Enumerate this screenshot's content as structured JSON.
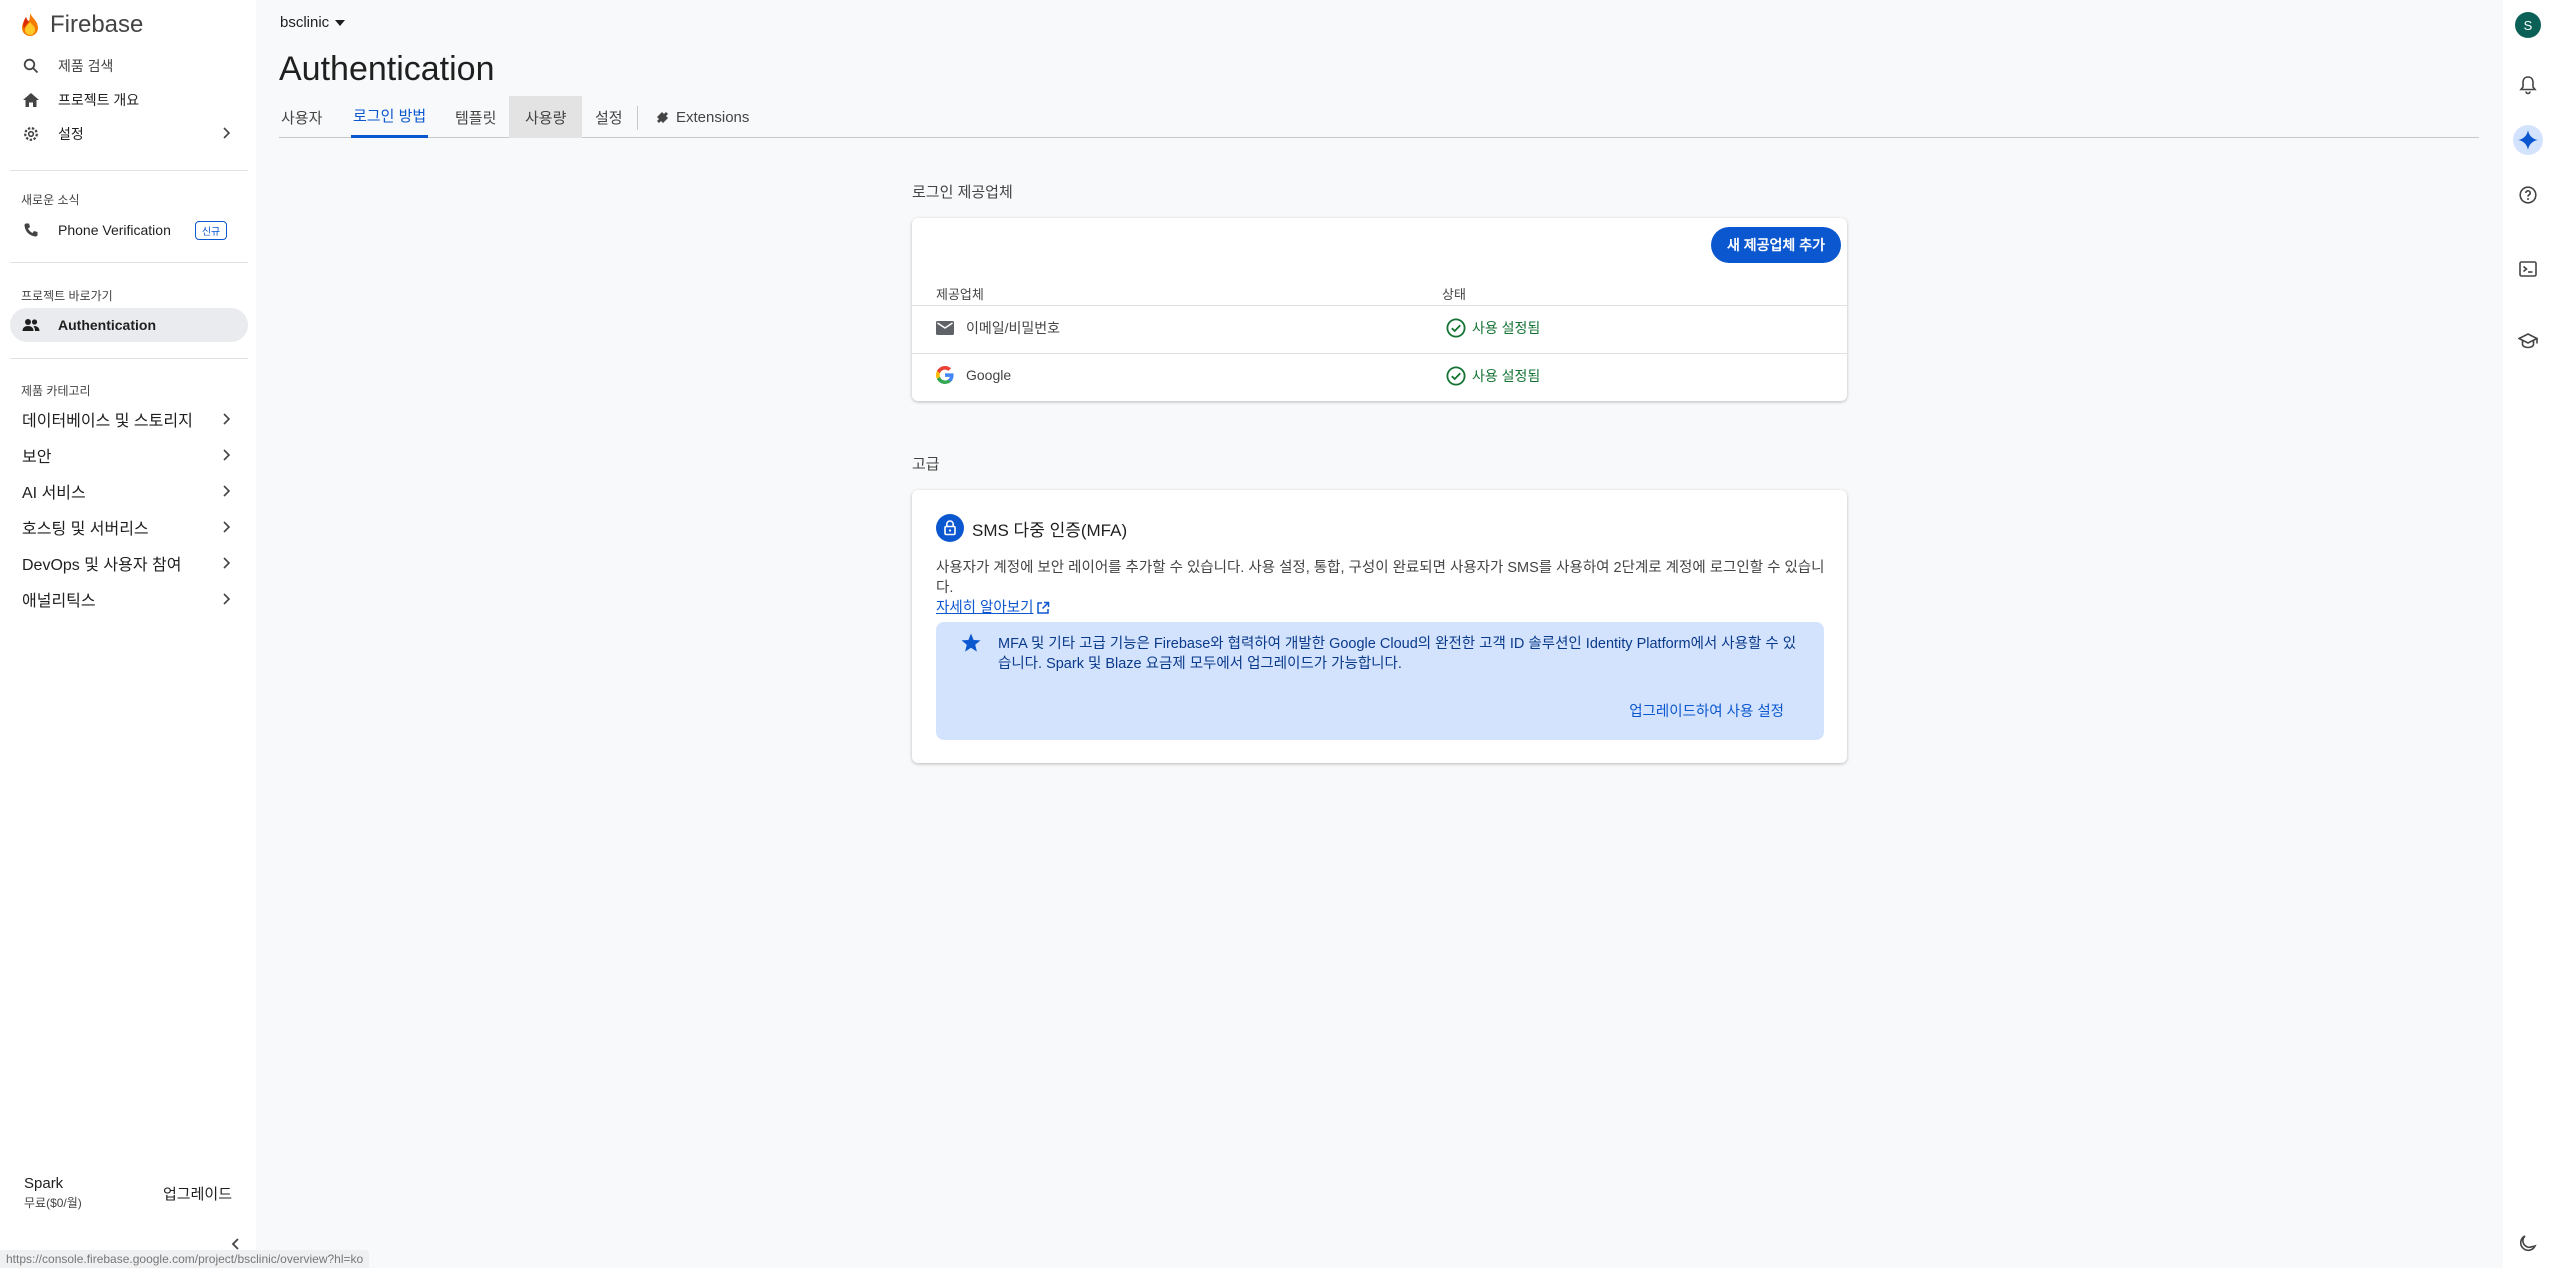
{
  "app": {
    "brand": "Firebase"
  },
  "sidebar": {
    "search": "제품 검색",
    "overview": "프로젝트 개요",
    "settings": "설정",
    "news_label": "새로운 소식",
    "news_item": "Phone Verification",
    "news_badge": "신규",
    "shortcuts_label": "프로젝트 바로가기",
    "shortcut_item": "Authentication",
    "categories_label": "제품 카테고리",
    "categories": [
      "데이터베이스 및 스토리지",
      "보안",
      "AI 서비스",
      "호스팅 및 서버리스",
      "DevOps 및 사용자 참여",
      "애널리틱스"
    ],
    "plan_name": "Spark",
    "plan_price": "무료($0/월)",
    "upgrade": "업그레이드"
  },
  "header": {
    "project": "bsclinic",
    "title": "Authentication",
    "tabs": [
      "사용자",
      "로그인 방법",
      "템플릿",
      "사용량",
      "설정",
      "Extensions"
    ]
  },
  "providers": {
    "section_label": "로그인 제공업체",
    "add_button": "새 제공업체 추가",
    "col_provider": "제공업체",
    "col_status": "상태",
    "rows": [
      {
        "name": "이메일/비밀번호",
        "status": "사용 설정됨"
      },
      {
        "name": "Google",
        "status": "사용 설정됨"
      }
    ]
  },
  "advanced": {
    "section_label": "고급",
    "mfa_title": "SMS 다중 인증(MFA)",
    "mfa_desc": "사용자가 계정에 보안 레이어를 추가할 수 있습니다. 사용 설정, 통합, 구성이 완료되면 사용자가 SMS를 사용하여 2단계로 계정에 로그인할 수 있습니다.",
    "learn_more": "자세히 알아보기",
    "notice_text": "MFA 및 기타 고급 기능은 Firebase와 협력하여 개발한 Google Cloud의 완전한 고객 ID 솔루션인 Identity Platform에서 사용할 수 있습니다. Spark 및 Blaze 요금제 모두에서 업그레이드가 가능합니다.",
    "notice_action": "업그레이드하여 사용 설정"
  },
  "rail": {
    "avatar_letter": "S"
  },
  "statusbar": {
    "url": "https://console.firebase.google.com/project/bsclinic/overview?hl=ko"
  },
  "colors": {
    "primary": "#0b57d0",
    "success": "#137333",
    "notice_bg": "#d3e3fd"
  }
}
